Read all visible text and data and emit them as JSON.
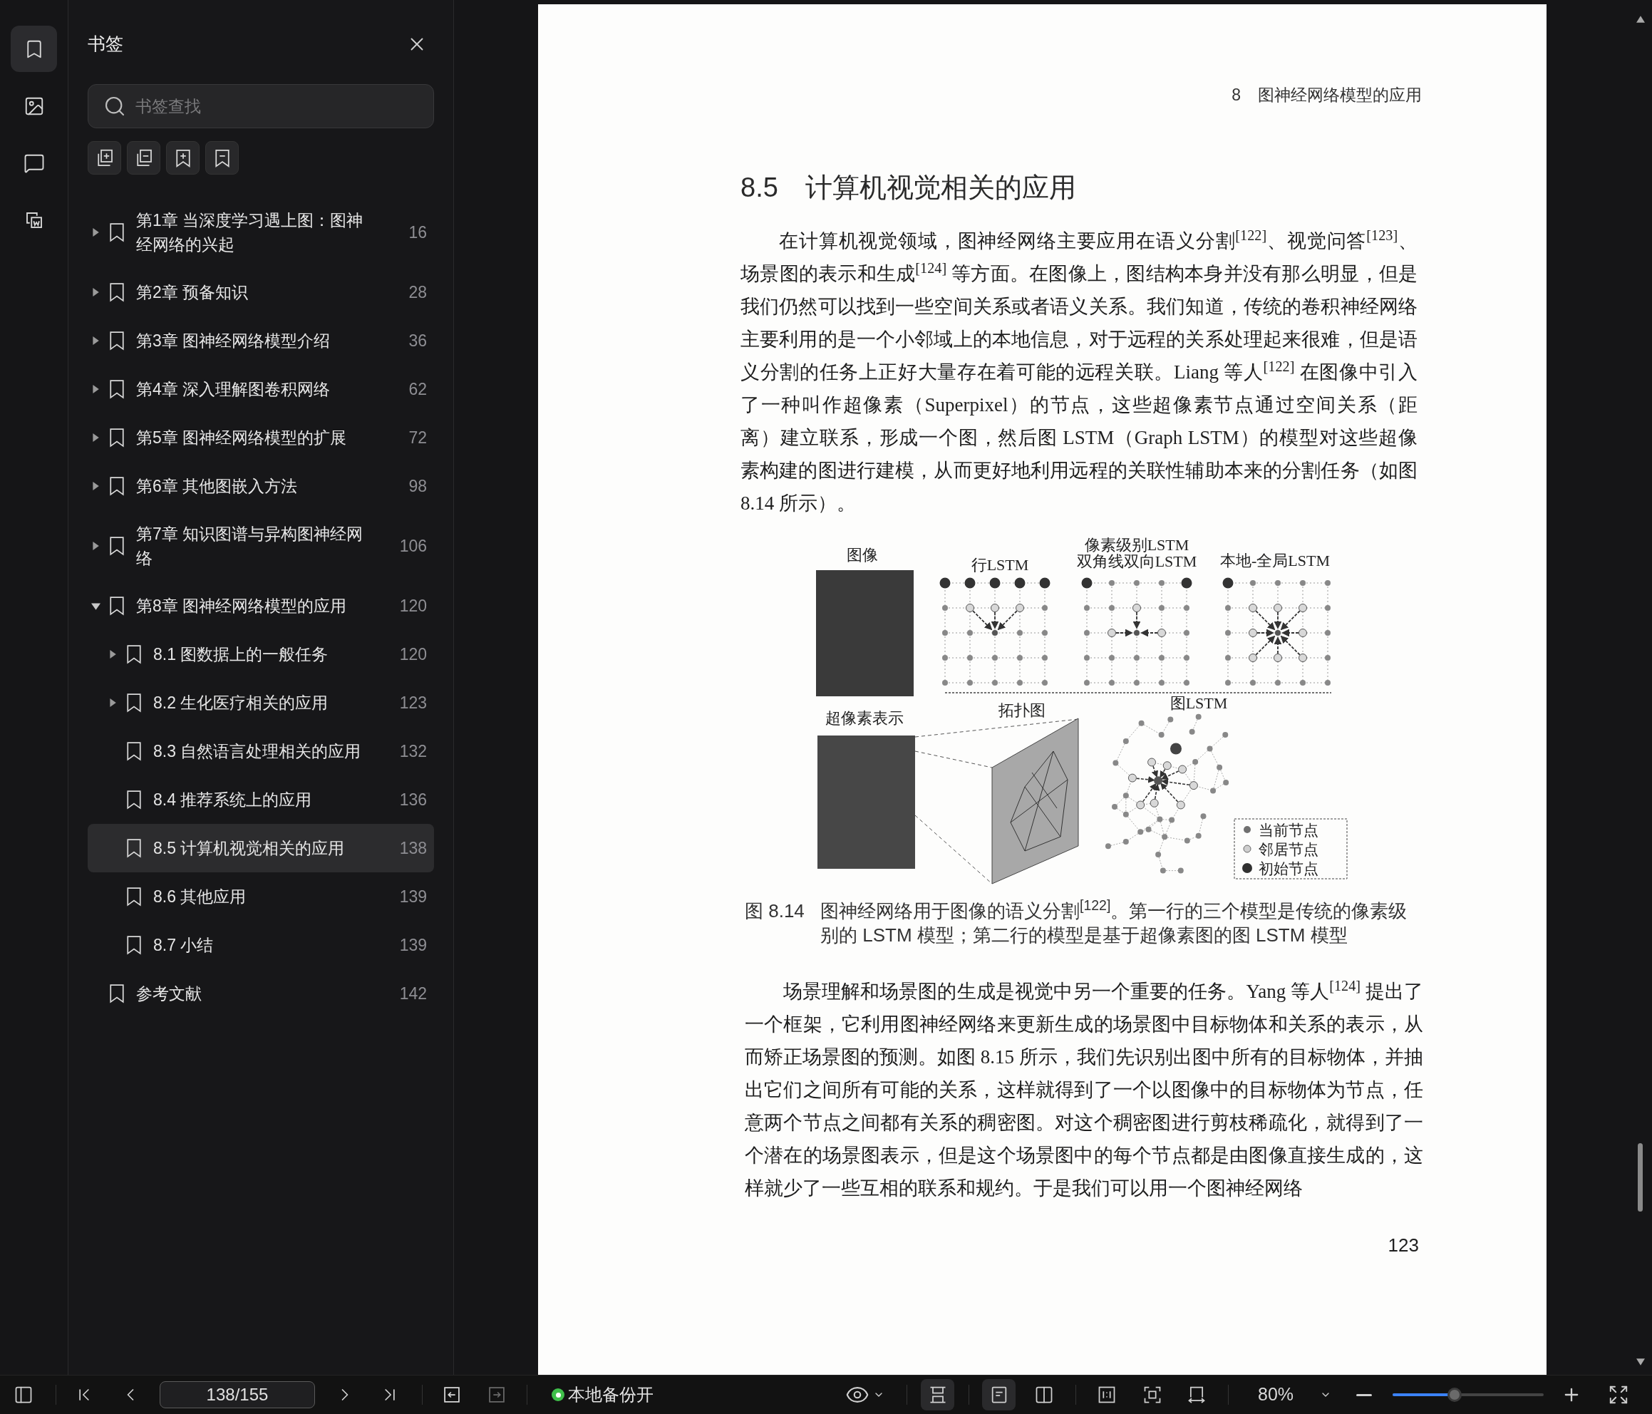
{
  "rail": {
    "items": [
      {
        "selected": true
      },
      {
        "selected": false
      },
      {
        "selected": false
      },
      {
        "selected": false
      }
    ]
  },
  "sidebar": {
    "title": "书签",
    "search": {
      "placeholder": "书签查找"
    },
    "bookmarks": [
      {
        "label": "第1章 当深度学习遇上图：图神经网络的兴起",
        "page": "16",
        "kind": "folder",
        "expanded": false,
        "selected": false
      },
      {
        "label": "第2章 预备知识",
        "page": "28",
        "kind": "folder",
        "expanded": false,
        "selected": false
      },
      {
        "label": "第3章 图神经网络模型介绍",
        "page": "36",
        "kind": "folder",
        "expanded": false,
        "selected": false
      },
      {
        "label": "第4章 深入理解图卷积网络",
        "page": "62",
        "kind": "folder",
        "expanded": false,
        "selected": false
      },
      {
        "label": "第5章 图神经网络模型的扩展",
        "page": "72",
        "kind": "folder",
        "expanded": false,
        "selected": false
      },
      {
        "label": "第6章 其他图嵌入方法",
        "page": "98",
        "kind": "folder",
        "expanded": false,
        "selected": false
      },
      {
        "label": "第7章 知识图谱与异构图神经网络",
        "page": "106",
        "kind": "folder",
        "expanded": false,
        "selected": false
      },
      {
        "label": "第8章 图神经网络模型的应用",
        "page": "120",
        "kind": "folder",
        "expanded": true,
        "selected": false,
        "children": [
          {
            "label": "8.1 图数据上的一般任务",
            "page": "120",
            "kind": "folder",
            "expanded": false,
            "selected": false
          },
          {
            "label": "8.2 生化医疗相关的应用",
            "page": "123",
            "kind": "folder",
            "expanded": false,
            "selected": false
          },
          {
            "label": "8.3 自然语言处理相关的应用",
            "page": "132",
            "kind": "leaf",
            "expanded": false,
            "selected": false
          },
          {
            "label": "8.4 推荐系统上的应用",
            "page": "136",
            "kind": "leaf",
            "expanded": false,
            "selected": false
          },
          {
            "label": "8.5 计算机视觉相关的应用",
            "page": "138",
            "kind": "leaf",
            "expanded": false,
            "selected": true
          },
          {
            "label": "8.6 其他应用",
            "page": "139",
            "kind": "leaf",
            "expanded": false,
            "selected": false
          },
          {
            "label": "8.7 小结",
            "page": "139",
            "kind": "leaf",
            "expanded": false,
            "selected": false
          }
        ]
      },
      {
        "label": "参考文献",
        "page": "142",
        "kind": "leaf",
        "expanded": false,
        "selected": false
      }
    ]
  },
  "page": {
    "running_head": {
      "number": "8",
      "title": "图神经网络模型的应用"
    },
    "section": {
      "number": "8.5",
      "title": "计算机视觉相关的应用"
    },
    "paragraph_1": "在计算机视觉领域，图神经网络主要应用在语义分割$^{[122]}$、视觉问答$^{[123]}$、场景图的表示和生成$^{[124]}$ 等方面。在图像上，图结构本身并没有那么明显，但是我们仍然可以找到一些空间关系或者语义关系。我们知道，传统的卷积神经网络主要利用的是一个小邻域上的本地信息，对于远程的关系处理起来很难，但是语义分割的任务上正好大量存在着可能的远程关联。Liang 等人$^{[122]}$ 在图像中引入了一种叫作超像素（Superpixel）的节点，这些超像素节点通过空间关系（距离）建立联系，形成一个图，然后图 LSTM（Graph LSTM）的模型对这些超像素构建的图进行建模，从而更好地利用远程的关联性辅助本来的分割任务（如图 8.14 所示）。",
    "figure": {
      "image_label": "图像",
      "row_lstm_label": "行LSTM",
      "pixel_lstm_label": "像素级别LSTM",
      "diagonal_lstm_label": "双角线双向LSTM",
      "local_global_lstm_label": "本地-全局LSTM",
      "superpixel_label": "超像素表示",
      "topology_label": "拓扑图",
      "graph_lstm_label": "图LSTM",
      "legend": [
        {
          "label": "当前节点",
          "color": "#707070"
        },
        {
          "label": "邻居节点",
          "color": "#cfcfcf"
        },
        {
          "label": "初始节点",
          "color": "#303030"
        }
      ],
      "caption": {
        "number": "图 8.14",
        "text": "图神经网络用于图像的语义分割$^{[122]}$。第一行的三个模型是传统的像素级别的 LSTM 模型；第二行的模型是基于超像素图的图 LSTM 模型"
      }
    },
    "paragraph_2": "场景理解和场景图的生成是视觉中另一个重要的任务。Yang 等人$^{[124]}$ 提出了一个框架，它利用图神经网络来更新生成的场景图中目标物体和关系的表示，从而矫正场景图的预测。如图 8.15 所示，我们先识别出图中所有的目标物体，并抽出它们之间所有可能的关系，这样就得到了一个以图像中的目标物体为节点，任意两个节点之间都有关系的稠密图。对这个稠密图进行剪枝稀疏化，就得到了一个潜在的场景图表示，但是这个场景图中的每个节点都是由图像直接生成的，这样就少了一些互相的联系和规约。于是我们可以用一个图神经网络",
    "page_number": "123"
  },
  "toolbar": {
    "page_field": {
      "value": "138/155"
    },
    "back": {
      "disabled": false
    },
    "forward": {
      "disabled": true
    },
    "backup": {
      "on": true,
      "label": "本地备份开"
    },
    "continuous_scroll": {
      "selected": true
    },
    "page_layouts": [
      {
        "selected": true
      },
      {
        "selected": false
      }
    ],
    "zoom": {
      "value": "80%",
      "level": 0.41
    }
  }
}
